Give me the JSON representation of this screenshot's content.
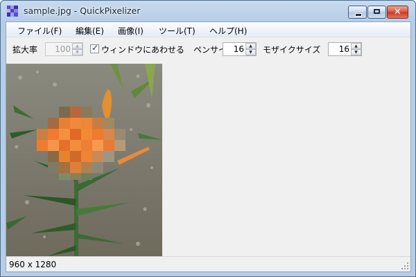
{
  "window": {
    "title": "sample.jpg - QuickPixelizer"
  },
  "menu": {
    "items": [
      {
        "label": "ファイル(F)"
      },
      {
        "label": "編集(E)"
      },
      {
        "label": "画像(I)"
      },
      {
        "label": "ツール(T)"
      },
      {
        "label": "ヘルプ(H)"
      }
    ]
  },
  "toolbar": {
    "zoom_label": "拡大率",
    "zoom_value": "100",
    "fit_window_label": "ウィンドウにあわせる",
    "fit_window_checked": true,
    "pen_size_label": "ペンサイズ",
    "pen_size_value": "16",
    "mosaic_size_label": "モザイクサイズ",
    "mosaic_size_value": "16"
  },
  "status": {
    "dimensions": "960 x 1280"
  },
  "icons": {
    "app": "pixel-mosaic-icon",
    "minimize": "minimize-icon",
    "maximize": "maximize-icon",
    "close": "close-icon",
    "check": "check-icon",
    "grip": "resize-grip-icon"
  },
  "colors": {
    "title_bar": "#b7cde6",
    "close_button": "#d9533a",
    "flower": "#f07a2e",
    "foliage": "#3f6b35"
  }
}
